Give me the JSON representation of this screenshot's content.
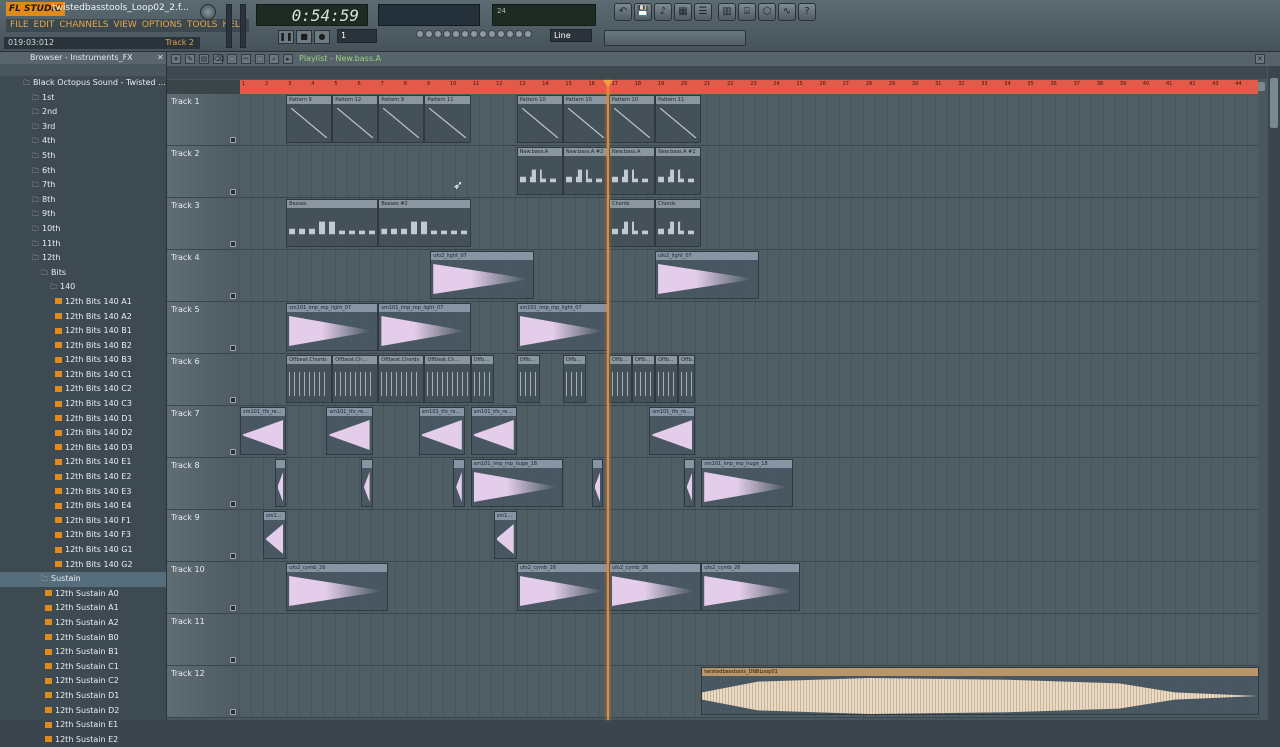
{
  "app": {
    "logo": "FL STUDIO",
    "title": "twistedbasstools_Loop02_2.f...",
    "menus": [
      "FILE",
      "EDIT",
      "CHANNELS",
      "VIEW",
      "OPTIONS",
      "TOOLS",
      "HELP"
    ],
    "hint_left": "019:03:012",
    "hint_right": "Track 2",
    "time": "0:54:59",
    "pattern": "1",
    "snap": "Line",
    "cpu_text": "24",
    "accent": "#e08a1c"
  },
  "icons": [
    "undo-icon",
    "save-icon",
    "piano-roll-icon",
    "mixer-icon",
    "playlist-icon",
    "step-seq-icon",
    "browser-icon",
    "plugin-icon",
    "wave-icon",
    "help-icon"
  ],
  "browser": {
    "title": "Browser - Instruments_FX",
    "items": [
      {
        "label": "Black Octopus Sound - Twisted ...",
        "type": "folder",
        "depth": 1
      },
      {
        "label": "1st",
        "type": "folder",
        "depth": 2
      },
      {
        "label": "2nd",
        "type": "folder",
        "depth": 2
      },
      {
        "label": "3rd",
        "type": "folder",
        "depth": 2
      },
      {
        "label": "4th",
        "type": "folder",
        "depth": 2
      },
      {
        "label": "5th",
        "type": "folder",
        "depth": 2
      },
      {
        "label": "6th",
        "type": "folder",
        "depth": 2
      },
      {
        "label": "7th",
        "type": "folder",
        "depth": 2
      },
      {
        "label": "8th",
        "type": "folder",
        "depth": 2
      },
      {
        "label": "9th",
        "type": "folder",
        "depth": 2
      },
      {
        "label": "10th",
        "type": "folder",
        "depth": 2
      },
      {
        "label": "11th",
        "type": "folder",
        "depth": 2
      },
      {
        "label": "12th",
        "type": "folder",
        "depth": 2
      },
      {
        "label": "Bits",
        "type": "folder",
        "depth": 3
      },
      {
        "label": "140",
        "type": "folder",
        "depth": 4
      },
      {
        "label": "12th Bits 140 A1",
        "type": "file",
        "depth": 5
      },
      {
        "label": "12th Bits 140 A2",
        "type": "file",
        "depth": 5
      },
      {
        "label": "12th Bits 140 B1",
        "type": "file",
        "depth": 5
      },
      {
        "label": "12th Bits 140 B2",
        "type": "file",
        "depth": 5
      },
      {
        "label": "12th Bits 140 B3",
        "type": "file",
        "depth": 5
      },
      {
        "label": "12th Bits 140 C1",
        "type": "file",
        "depth": 5
      },
      {
        "label": "12th Bits 140 C2",
        "type": "file",
        "depth": 5
      },
      {
        "label": "12th Bits 140 C3",
        "type": "file",
        "depth": 5
      },
      {
        "label": "12th Bits 140 D1",
        "type": "file",
        "depth": 5
      },
      {
        "label": "12th Bits 140 D2",
        "type": "file",
        "depth": 5
      },
      {
        "label": "12th Bits 140 D3",
        "type": "file",
        "depth": 5
      },
      {
        "label": "12th Bits 140 E1",
        "type": "file",
        "depth": 5
      },
      {
        "label": "12th Bits 140 E2",
        "type": "file",
        "depth": 5
      },
      {
        "label": "12th Bits 140 E3",
        "type": "file",
        "depth": 5
      },
      {
        "label": "12th Bits 140 E4",
        "type": "file",
        "depth": 5
      },
      {
        "label": "12th Bits 140 F1",
        "type": "file",
        "depth": 5
      },
      {
        "label": "12th Bits 140 F3",
        "type": "file",
        "depth": 5
      },
      {
        "label": "12th Bits 140 G1",
        "type": "file",
        "depth": 5
      },
      {
        "label": "12th Bits 140 G2",
        "type": "file",
        "depth": 5
      },
      {
        "label": "Sustain",
        "type": "folder",
        "depth": 3,
        "selected": true
      },
      {
        "label": "12th Sustain A0",
        "type": "file",
        "depth": 4
      },
      {
        "label": "12th Sustain A1",
        "type": "file",
        "depth": 4
      },
      {
        "label": "12th Sustain A2",
        "type": "file",
        "depth": 4
      },
      {
        "label": "12th Sustain B0",
        "type": "file",
        "depth": 4
      },
      {
        "label": "12th Sustain B1",
        "type": "file",
        "depth": 4
      },
      {
        "label": "12th Sustain C1",
        "type": "file",
        "depth": 4
      },
      {
        "label": "12th Sustain C2",
        "type": "file",
        "depth": 4
      },
      {
        "label": "12th Sustain D1",
        "type": "file",
        "depth": 4
      },
      {
        "label": "12th Sustain D2",
        "type": "file",
        "depth": 4
      },
      {
        "label": "12th Sustain E1",
        "type": "file",
        "depth": 4
      },
      {
        "label": "12th Sustain E2",
        "type": "file",
        "depth": 4
      }
    ]
  },
  "playlist": {
    "title": "Playlist - New.bass.A",
    "ruler_label": "",
    "tracks": [
      {
        "name": "Track 1",
        "clips": [
          {
            "label": "Pattern 9",
            "kind": "pat",
            "viz": "ramp",
            "start": 4,
            "len": 4
          },
          {
            "label": "Pattern 12",
            "kind": "pat",
            "viz": "ramp",
            "start": 8,
            "len": 4
          },
          {
            "label": "Pattern 9",
            "kind": "pat",
            "viz": "ramp",
            "start": 12,
            "len": 4
          },
          {
            "label": "Pattern 11",
            "kind": "pat",
            "viz": "ramp",
            "start": 16,
            "len": 4
          },
          {
            "label": "Pattern 10",
            "kind": "pat",
            "viz": "ramp",
            "start": 24,
            "len": 4
          },
          {
            "label": "Pattern 10",
            "kind": "pat",
            "viz": "ramp",
            "start": 28,
            "len": 4
          },
          {
            "label": "Pattern 10",
            "kind": "pat",
            "viz": "ramp",
            "start": 32,
            "len": 4
          },
          {
            "label": "Pattern 11",
            "kind": "pat",
            "viz": "ramp",
            "start": 36,
            "len": 4
          }
        ]
      },
      {
        "name": "Track 2",
        "clips": [
          {
            "label": "New.bass.A",
            "kind": "pat",
            "viz": "notes",
            "start": 24,
            "len": 4
          },
          {
            "label": "New.bass.A #2",
            "kind": "pat",
            "viz": "notes",
            "start": 28,
            "len": 4
          },
          {
            "label": "New.bass.A",
            "kind": "pat",
            "viz": "notes",
            "start": 32,
            "len": 4
          },
          {
            "label": "New.bass.A #2",
            "kind": "pat",
            "viz": "notes",
            "start": 36,
            "len": 4
          }
        ]
      },
      {
        "name": "Track 3",
        "clips": [
          {
            "label": "Basses",
            "kind": "pat",
            "viz": "notes",
            "start": 4,
            "len": 8
          },
          {
            "label": "Basses #2",
            "kind": "pat",
            "viz": "notes",
            "start": 12,
            "len": 8
          },
          {
            "label": "Chords",
            "kind": "pat",
            "viz": "notes",
            "start": 32,
            "len": 4
          },
          {
            "label": "Chords",
            "kind": "pat",
            "viz": "notes",
            "start": 36,
            "len": 4
          }
        ]
      },
      {
        "name": "Track 4",
        "clips": [
          {
            "label": "ufo2_light_07",
            "kind": "smp",
            "viz": "wave",
            "start": 16.5,
            "len": 9
          },
          {
            "label": "ufo2_light_07",
            "kind": "smp",
            "viz": "wave",
            "start": 36,
            "len": 9
          }
        ]
      },
      {
        "name": "Track 5",
        "clips": [
          {
            "label": "sm101_imp_mp_light_07",
            "kind": "smp",
            "viz": "wave",
            "start": 4,
            "len": 8
          },
          {
            "label": "sm101_imp_mp_light_07",
            "kind": "smp",
            "viz": "wave",
            "start": 12,
            "len": 8
          },
          {
            "label": "sm101_imp_mp_light_07",
            "kind": "smp",
            "viz": "wave",
            "start": 24,
            "len": 8
          }
        ]
      },
      {
        "name": "Track 6",
        "clips": [
          {
            "label": "Offbeat.Chords",
            "kind": "pat",
            "viz": "ticks",
            "start": 4,
            "len": 4
          },
          {
            "label": "Offbeat.Ch...",
            "kind": "pat",
            "viz": "ticks",
            "start": 8,
            "len": 4
          },
          {
            "label": "Offbeat.Chords",
            "kind": "pat",
            "viz": "ticks",
            "start": 12,
            "len": 4
          },
          {
            "label": "Offbeat.Ch...",
            "kind": "pat",
            "viz": "ticks",
            "start": 16,
            "len": 4
          },
          {
            "label": "Offb...",
            "kind": "pat",
            "viz": "ticks",
            "start": 20,
            "len": 2
          },
          {
            "label": "Offb...",
            "kind": "pat",
            "viz": "ticks",
            "start": 24,
            "len": 2
          },
          {
            "label": "Offb...",
            "kind": "pat",
            "viz": "ticks",
            "start": 28,
            "len": 2
          },
          {
            "label": "Offb...",
            "kind": "pat",
            "viz": "ticks",
            "start": 32,
            "len": 2
          },
          {
            "label": "Offb...",
            "kind": "pat",
            "viz": "ticks",
            "start": 34,
            "len": 2
          },
          {
            "label": "Offb...",
            "kind": "pat",
            "viz": "ticks",
            "start": 36,
            "len": 2
          },
          {
            "label": "Offb...",
            "kind": "pat",
            "viz": "ticks",
            "start": 38,
            "len": 1.5
          }
        ]
      },
      {
        "name": "Track 7",
        "clips": [
          {
            "label": "sm101_tfx_re...",
            "kind": "smp",
            "viz": "wavein",
            "start": 0,
            "len": 4
          },
          {
            "label": "sm101_tfx_re...",
            "kind": "smp",
            "viz": "wavein",
            "start": 7.5,
            "len": 4
          },
          {
            "label": "sm101_tfx_re...",
            "kind": "smp",
            "viz": "wavein",
            "start": 15.5,
            "len": 4
          },
          {
            "label": "sm101_tfx_re...",
            "kind": "smp",
            "viz": "wavein",
            "start": 20,
            "len": 4
          },
          {
            "label": "sm101_tfx_re...",
            "kind": "smp",
            "viz": "wavein",
            "start": 35.5,
            "len": 4
          }
        ]
      },
      {
        "name": "Track 8",
        "clips": [
          {
            "label": "",
            "kind": "smp",
            "viz": "wavein",
            "start": 3,
            "len": 1
          },
          {
            "label": "",
            "kind": "smp",
            "viz": "wavein",
            "start": 10.5,
            "len": 1
          },
          {
            "label": "",
            "kind": "smp",
            "viz": "wavein",
            "start": 18.5,
            "len": 1
          },
          {
            "label": "sm101_imp_mp_huge_18",
            "kind": "smp",
            "viz": "wave",
            "start": 20,
            "len": 8
          },
          {
            "label": "",
            "kind": "smp",
            "viz": "wavein",
            "start": 30.5,
            "len": 1
          },
          {
            "label": "",
            "kind": "smp",
            "viz": "wavein",
            "start": 38.5,
            "len": 1
          },
          {
            "label": "sm101_imp_mp_huge_18",
            "kind": "smp",
            "viz": "wave",
            "start": 40,
            "len": 8
          }
        ]
      },
      {
        "name": "Track 9",
        "clips": [
          {
            "label": "sm1...",
            "kind": "smp",
            "viz": "wavein",
            "start": 2,
            "len": 2
          },
          {
            "label": "sm1...",
            "kind": "smp",
            "viz": "wavein",
            "start": 22,
            "len": 2
          }
        ]
      },
      {
        "name": "Track 10",
        "clips": [
          {
            "label": "ufo2_cymb_26",
            "kind": "smp",
            "viz": "wave",
            "start": 4,
            "len": 8.8
          },
          {
            "label": "ufo2_cymb_26",
            "kind": "smp",
            "viz": "wave",
            "start": 24,
            "len": 8
          },
          {
            "label": "ufo2_cymb_26",
            "kind": "smp",
            "viz": "wave",
            "start": 32,
            "len": 8
          },
          {
            "label": "ufo2_cymb_26",
            "kind": "smp",
            "viz": "wave",
            "start": 40,
            "len": 8.6
          }
        ]
      },
      {
        "name": "Track 11",
        "clips": []
      },
      {
        "name": "Track 12",
        "clips": [
          {
            "label": "twistedbasstools_DNBLoop01",
            "kind": "ts",
            "viz": "bigwave",
            "start": 40,
            "len": 48.4
          }
        ]
      }
    ]
  }
}
